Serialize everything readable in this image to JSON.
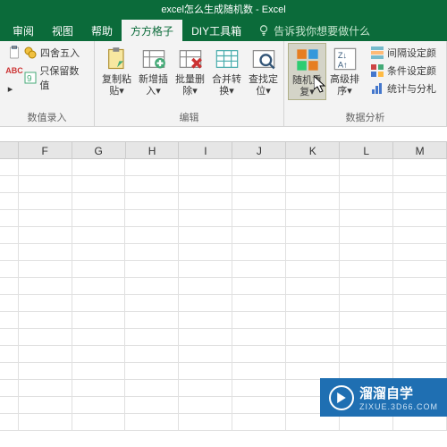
{
  "title": "excel怎么生成随机数 - Excel",
  "tabs": {
    "items": [
      "审阅",
      "视图",
      "帮助",
      "方方格子",
      "DIY工具箱"
    ],
    "active": 3,
    "tellme": "告诉我你想要做什么"
  },
  "ribbon": {
    "group1": {
      "label": "数值录入",
      "round": "四舍五入",
      "keep": "只保留数值",
      "abc": "ABC"
    },
    "group2": {
      "label": "编辑",
      "paste": "复制粘\n贴▾",
      "insert": "新增插\n入▾",
      "delete": "批量删\n除▾",
      "merge": "合并转\n换▾",
      "find": "查找定\n位▾"
    },
    "group3": {
      "label": "数据分析",
      "random": "随机重\n复▾",
      "sort": "高级排\n序▾",
      "interval": "间隔设定颜",
      "cond": "条件设定颜",
      "stats": "统计与分札"
    }
  },
  "columns": [
    "F",
    "G",
    "H",
    "I",
    "J",
    "K",
    "L",
    "M"
  ],
  "watermark": {
    "brand": "溜溜自学",
    "url": "ZIXUE.3D66.COM"
  }
}
